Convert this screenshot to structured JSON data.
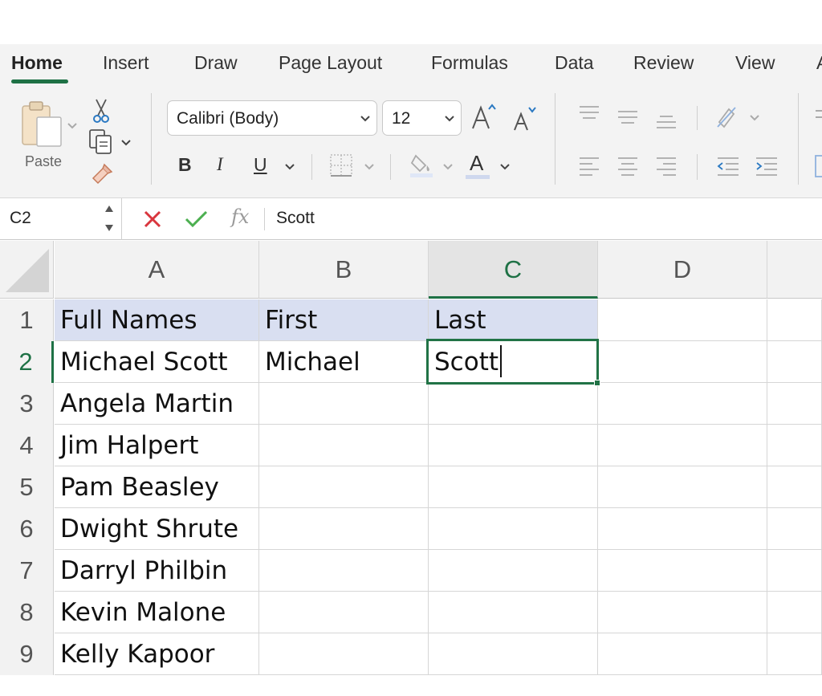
{
  "ribbon": {
    "tabs": [
      "Home",
      "Insert",
      "Draw",
      "Page Layout",
      "Formulas",
      "Data",
      "Review",
      "View",
      "A"
    ],
    "active_tab": "Home",
    "clipboard": {
      "paste_label": "Paste"
    },
    "font": {
      "name": "Calibri (Body)",
      "size": "12"
    },
    "format_buttons": {
      "bold": "B",
      "italic": "I",
      "underline": "U",
      "font_color": "A"
    }
  },
  "formula_bar": {
    "name_box": "C2",
    "fx_label": "fx",
    "formula": "Scott"
  },
  "sheet": {
    "columns": [
      "A",
      "B",
      "C",
      "D"
    ],
    "selected_column": "C",
    "selected_row": "2",
    "active_cell": "C2",
    "rows": [
      {
        "num": "1",
        "cells": [
          "Full Names",
          "First",
          "Last",
          ""
        ]
      },
      {
        "num": "2",
        "cells": [
          "Michael Scott",
          "Michael",
          "Scott",
          ""
        ]
      },
      {
        "num": "3",
        "cells": [
          "Angela Martin",
          "",
          "",
          ""
        ]
      },
      {
        "num": "4",
        "cells": [
          "Jim Halpert",
          "",
          "",
          ""
        ]
      },
      {
        "num": "5",
        "cells": [
          "Pam Beasley",
          "",
          "",
          ""
        ]
      },
      {
        "num": "6",
        "cells": [
          "Dwight Shrute",
          "",
          "",
          ""
        ]
      },
      {
        "num": "7",
        "cells": [
          "Darryl Philbin",
          "",
          "",
          ""
        ]
      },
      {
        "num": "8",
        "cells": [
          "Kevin Malone",
          "",
          "",
          ""
        ]
      },
      {
        "num": "9",
        "cells": [
          "Kelly Kapoor",
          "",
          "",
          ""
        ]
      }
    ]
  },
  "colors": {
    "accent": "#1e7145",
    "header_row_fill": "#d9dff1",
    "cancel": "#d9363e",
    "confirm": "#4caf50"
  }
}
